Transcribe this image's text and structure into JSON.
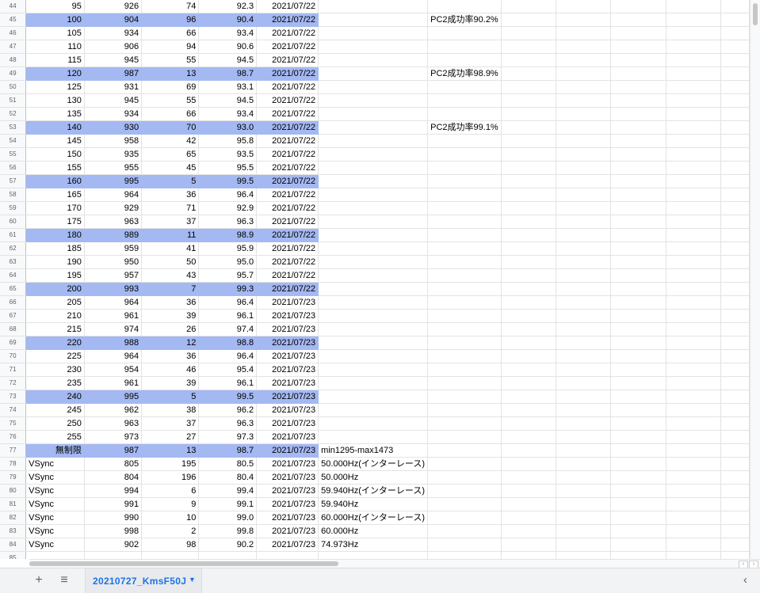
{
  "rows": [
    {
      "n": "44",
      "a": "95",
      "b": "926",
      "c": "74",
      "d": "92.3",
      "e": "2021/07/22",
      "f": "",
      "g": "",
      "hl": false
    },
    {
      "n": "45",
      "a": "100",
      "b": "904",
      "c": "96",
      "d": "90.4",
      "e": "2021/07/22",
      "f": "",
      "g": "PC2成功率90.2%",
      "hl": true
    },
    {
      "n": "46",
      "a": "105",
      "b": "934",
      "c": "66",
      "d": "93.4",
      "e": "2021/07/22",
      "f": "",
      "g": "",
      "hl": false
    },
    {
      "n": "47",
      "a": "110",
      "b": "906",
      "c": "94",
      "d": "90.6",
      "e": "2021/07/22",
      "f": "",
      "g": "",
      "hl": false
    },
    {
      "n": "48",
      "a": "115",
      "b": "945",
      "c": "55",
      "d": "94.5",
      "e": "2021/07/22",
      "f": "",
      "g": "",
      "hl": false
    },
    {
      "n": "49",
      "a": "120",
      "b": "987",
      "c": "13",
      "d": "98.7",
      "e": "2021/07/22",
      "f": "",
      "g": "PC2成功率98.9%",
      "hl": true
    },
    {
      "n": "50",
      "a": "125",
      "b": "931",
      "c": "69",
      "d": "93.1",
      "e": "2021/07/22",
      "f": "",
      "g": "",
      "hl": false
    },
    {
      "n": "51",
      "a": "130",
      "b": "945",
      "c": "55",
      "d": "94.5",
      "e": "2021/07/22",
      "f": "",
      "g": "",
      "hl": false
    },
    {
      "n": "52",
      "a": "135",
      "b": "934",
      "c": "66",
      "d": "93.4",
      "e": "2021/07/22",
      "f": "",
      "g": "",
      "hl": false
    },
    {
      "n": "53",
      "a": "140",
      "b": "930",
      "c": "70",
      "d": "93.0",
      "e": "2021/07/22",
      "f": "",
      "g": "PC2成功率99.1%",
      "hl": true
    },
    {
      "n": "54",
      "a": "145",
      "b": "958",
      "c": "42",
      "d": "95.8",
      "e": "2021/07/22",
      "f": "",
      "g": "",
      "hl": false
    },
    {
      "n": "55",
      "a": "150",
      "b": "935",
      "c": "65",
      "d": "93.5",
      "e": "2021/07/22",
      "f": "",
      "g": "",
      "hl": false
    },
    {
      "n": "56",
      "a": "155",
      "b": "955",
      "c": "45",
      "d": "95.5",
      "e": "2021/07/22",
      "f": "",
      "g": "",
      "hl": false
    },
    {
      "n": "57",
      "a": "160",
      "b": "995",
      "c": "5",
      "d": "99.5",
      "e": "2021/07/22",
      "f": "",
      "g": "",
      "hl": true
    },
    {
      "n": "58",
      "a": "165",
      "b": "964",
      "c": "36",
      "d": "96.4",
      "e": "2021/07/22",
      "f": "",
      "g": "",
      "hl": false
    },
    {
      "n": "59",
      "a": "170",
      "b": "929",
      "c": "71",
      "d": "92.9",
      "e": "2021/07/22",
      "f": "",
      "g": "",
      "hl": false
    },
    {
      "n": "60",
      "a": "175",
      "b": "963",
      "c": "37",
      "d": "96.3",
      "e": "2021/07/22",
      "f": "",
      "g": "",
      "hl": false
    },
    {
      "n": "61",
      "a": "180",
      "b": "989",
      "c": "11",
      "d": "98.9",
      "e": "2021/07/22",
      "f": "",
      "g": "",
      "hl": true
    },
    {
      "n": "62",
      "a": "185",
      "b": "959",
      "c": "41",
      "d": "95.9",
      "e": "2021/07/22",
      "f": "",
      "g": "",
      "hl": false
    },
    {
      "n": "63",
      "a": "190",
      "b": "950",
      "c": "50",
      "d": "95.0",
      "e": "2021/07/22",
      "f": "",
      "g": "",
      "hl": false
    },
    {
      "n": "64",
      "a": "195",
      "b": "957",
      "c": "43",
      "d": "95.7",
      "e": "2021/07/22",
      "f": "",
      "g": "",
      "hl": false
    },
    {
      "n": "65",
      "a": "200",
      "b": "993",
      "c": "7",
      "d": "99.3",
      "e": "2021/07/22",
      "f": "",
      "g": "",
      "hl": true
    },
    {
      "n": "66",
      "a": "205",
      "b": "964",
      "c": "36",
      "d": "96.4",
      "e": "2021/07/23",
      "f": "",
      "g": "",
      "hl": false
    },
    {
      "n": "67",
      "a": "210",
      "b": "961",
      "c": "39",
      "d": "96.1",
      "e": "2021/07/23",
      "f": "",
      "g": "",
      "hl": false
    },
    {
      "n": "68",
      "a": "215",
      "b": "974",
      "c": "26",
      "d": "97.4",
      "e": "2021/07/23",
      "f": "",
      "g": "",
      "hl": false
    },
    {
      "n": "69",
      "a": "220",
      "b": "988",
      "c": "12",
      "d": "98.8",
      "e": "2021/07/23",
      "f": "",
      "g": "",
      "hl": true
    },
    {
      "n": "70",
      "a": "225",
      "b": "964",
      "c": "36",
      "d": "96.4",
      "e": "2021/07/23",
      "f": "",
      "g": "",
      "hl": false
    },
    {
      "n": "71",
      "a": "230",
      "b": "954",
      "c": "46",
      "d": "95.4",
      "e": "2021/07/23",
      "f": "",
      "g": "",
      "hl": false
    },
    {
      "n": "72",
      "a": "235",
      "b": "961",
      "c": "39",
      "d": "96.1",
      "e": "2021/07/23",
      "f": "",
      "g": "",
      "hl": false
    },
    {
      "n": "73",
      "a": "240",
      "b": "995",
      "c": "5",
      "d": "99.5",
      "e": "2021/07/23",
      "f": "",
      "g": "",
      "hl": true
    },
    {
      "n": "74",
      "a": "245",
      "b": "962",
      "c": "38",
      "d": "96.2",
      "e": "2021/07/23",
      "f": "",
      "g": "",
      "hl": false
    },
    {
      "n": "75",
      "a": "250",
      "b": "963",
      "c": "37",
      "d": "96.3",
      "e": "2021/07/23",
      "f": "",
      "g": "",
      "hl": false
    },
    {
      "n": "76",
      "a": "255",
      "b": "973",
      "c": "27",
      "d": "97.3",
      "e": "2021/07/23",
      "f": "",
      "g": "",
      "hl": false
    },
    {
      "n": "77",
      "a": "無制限",
      "b": "987",
      "c": "13",
      "d": "98.7",
      "e": "2021/07/23",
      "f": "min1295-max1473",
      "g": "",
      "hl": true
    },
    {
      "n": "78",
      "a": "VSync",
      "b": "805",
      "c": "195",
      "d": "80.5",
      "e": "2021/07/23",
      "f": "50.000Hz(インターレース)",
      "g": "",
      "hl": false,
      "al": true
    },
    {
      "n": "79",
      "a": "VSync",
      "b": "804",
      "c": "196",
      "d": "80.4",
      "e": "2021/07/23",
      "f": "50.000Hz",
      "g": "",
      "hl": false,
      "al": true
    },
    {
      "n": "80",
      "a": "VSync",
      "b": "994",
      "c": "6",
      "d": "99.4",
      "e": "2021/07/23",
      "f": "59.940Hz(インターレース)",
      "g": "",
      "hl": false,
      "al": true
    },
    {
      "n": "81",
      "a": "VSync",
      "b": "991",
      "c": "9",
      "d": "99.1",
      "e": "2021/07/23",
      "f": "59.940Hz",
      "g": "",
      "hl": false,
      "al": true
    },
    {
      "n": "82",
      "a": "VSync",
      "b": "990",
      "c": "10",
      "d": "99.0",
      "e": "2021/07/23",
      "f": "60.000Hz(インターレース)",
      "g": "",
      "hl": false,
      "al": true
    },
    {
      "n": "83",
      "a": "VSync",
      "b": "998",
      "c": "2",
      "d": "99.8",
      "e": "2021/07/23",
      "f": "60.000Hz",
      "g": "",
      "hl": false,
      "al": true
    },
    {
      "n": "84",
      "a": "VSync",
      "b": "902",
      "c": "98",
      "d": "90.2",
      "e": "2021/07/23",
      "f": "74.973Hz",
      "g": "",
      "hl": false,
      "al": true
    },
    {
      "n": "85",
      "a": "",
      "b": "",
      "c": "",
      "d": "",
      "e": "",
      "f": "",
      "g": "",
      "hl": false
    }
  ],
  "highlight_color": "#a4b8f2",
  "tabbar": {
    "add_sheet_icon": "+",
    "all_sheets_icon": "≡",
    "active_tab_label": "20210727_KmsF50J",
    "tab_menu_icon": "▼",
    "nav_left_icon": "‹"
  },
  "scroll": {
    "left_arrow": "‹",
    "right_arrow": "›"
  }
}
